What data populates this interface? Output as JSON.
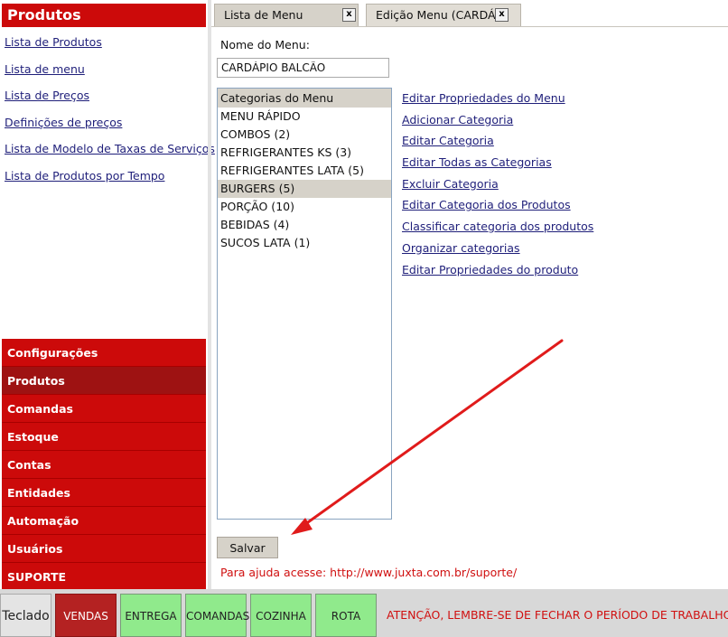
{
  "sidebar": {
    "title": "Produtos",
    "links": [
      "Lista de Produtos",
      "Lista de menu",
      "Lista de Preços",
      "Definições de preços",
      "Lista de Modelo de Taxas de Serviços",
      "Lista de Produtos por Tempo"
    ],
    "nav": [
      "Configurações",
      "Produtos",
      "Comandas",
      "Estoque",
      "Contas",
      "Entidades",
      "Automação",
      "Usuários",
      "SUPORTE"
    ],
    "active_nav": "Produtos"
  },
  "tabs": [
    {
      "label": "Lista de Menu",
      "close": "x"
    },
    {
      "label": "Edição Menu (CARDÁ",
      "close": "x"
    }
  ],
  "form": {
    "menu_name_label": "Nome do Menu:",
    "menu_name_value": "CARDÁPIO BALCÃO"
  },
  "category_list": {
    "header": "Categorias do Menu",
    "items": [
      "MENU RÁPIDO",
      "COMBOS (2)",
      "REFRIGERANTES KS (3)",
      "REFRIGERANTES LATA (5)",
      "BURGERS (5)",
      "PORÇÃO (10)",
      "BEBIDAS (4)",
      "SUCOS LATA (1)"
    ],
    "selected": "BURGERS (5)"
  },
  "actions": [
    "Editar Propriedades do Menu",
    "Adicionar Categoria",
    "Editar Categoria",
    "Editar Todas as Categorias",
    "Excluir Categoria",
    "Editar Categoria dos Produtos",
    "Classificar categoria dos produtos",
    "Organizar categorias",
    "Editar Propriedades do produto"
  ],
  "save_label": "Salvar",
  "help_text": "Para ajuda acesse: http://www.juxta.com.br/suporte/",
  "bottom_bar": {
    "teclado": "Teclado",
    "buttons": [
      "VENDAS",
      "ENTREGA",
      "COMANDAS",
      "COZINHA",
      "ROTA"
    ],
    "warning": "ATENÇÃO, LEMBRE-SE DE FECHAR O PERÍODO DE TRABALHO!"
  },
  "colors": {
    "brand_red": "#cc0a0a",
    "active_red": "#9e1212",
    "button_green": "#90ea8c",
    "link_blue": "#1f1f7a",
    "arrow_red": "#e01b1b"
  }
}
